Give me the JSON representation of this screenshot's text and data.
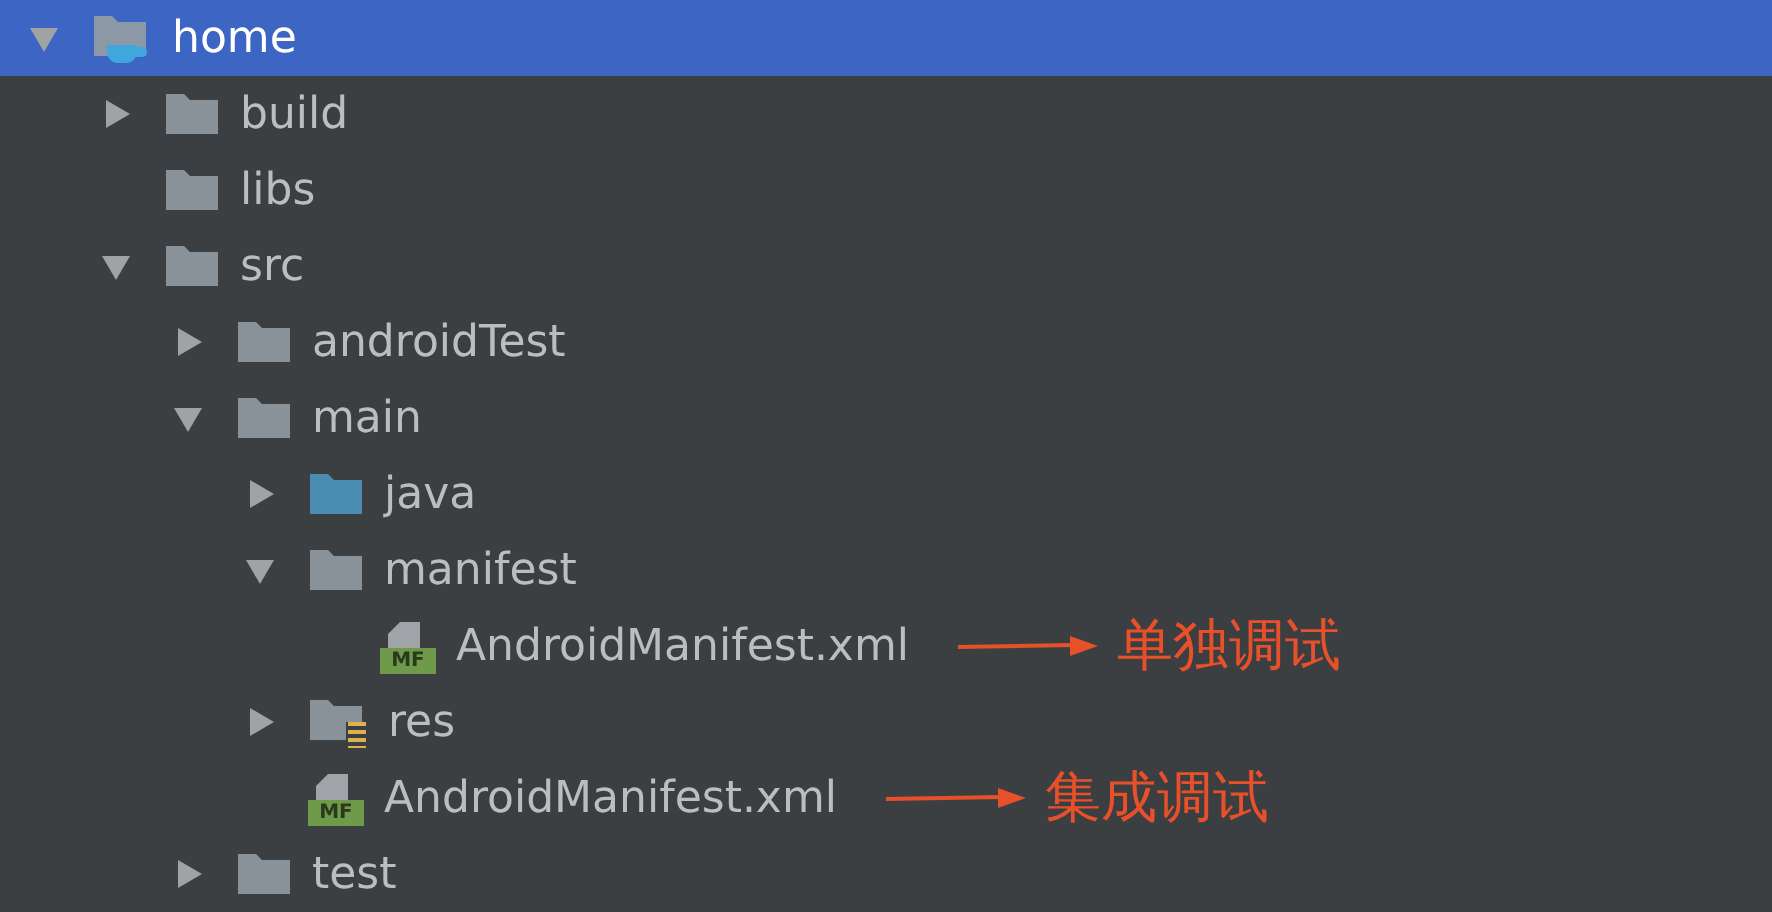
{
  "tree": [
    {
      "label": "home",
      "kind": "module",
      "expanded": true,
      "selected": true,
      "children": [
        {
          "label": "build",
          "kind": "folder",
          "expanded": false,
          "selected": false
        },
        {
          "label": "libs",
          "kind": "folder",
          "selected": false
        },
        {
          "label": "src",
          "kind": "folder",
          "expanded": true,
          "selected": false,
          "children": [
            {
              "label": "androidTest",
              "kind": "folder",
              "expanded": false,
              "selected": false
            },
            {
              "label": "main",
              "kind": "folder",
              "expanded": true,
              "selected": false,
              "children": [
                {
                  "label": "java",
                  "kind": "source-folder",
                  "expanded": false,
                  "selected": false
                },
                {
                  "label": "manifest",
                  "kind": "folder",
                  "expanded": true,
                  "selected": false,
                  "children": [
                    {
                      "label": "AndroidManifest.xml",
                      "kind": "manifest-file",
                      "badge": "MF",
                      "selected": false,
                      "note": "单独调试"
                    }
                  ]
                },
                {
                  "label": "res",
                  "kind": "resource-folder",
                  "expanded": false,
                  "selected": false
                },
                {
                  "label": "AndroidManifest.xml",
                  "kind": "manifest-file",
                  "badge": "MF",
                  "selected": false,
                  "note": "集成调试"
                }
              ]
            },
            {
              "label": "test",
              "kind": "folder",
              "expanded": false,
              "selected": false
            }
          ]
        }
      ]
    }
  ]
}
